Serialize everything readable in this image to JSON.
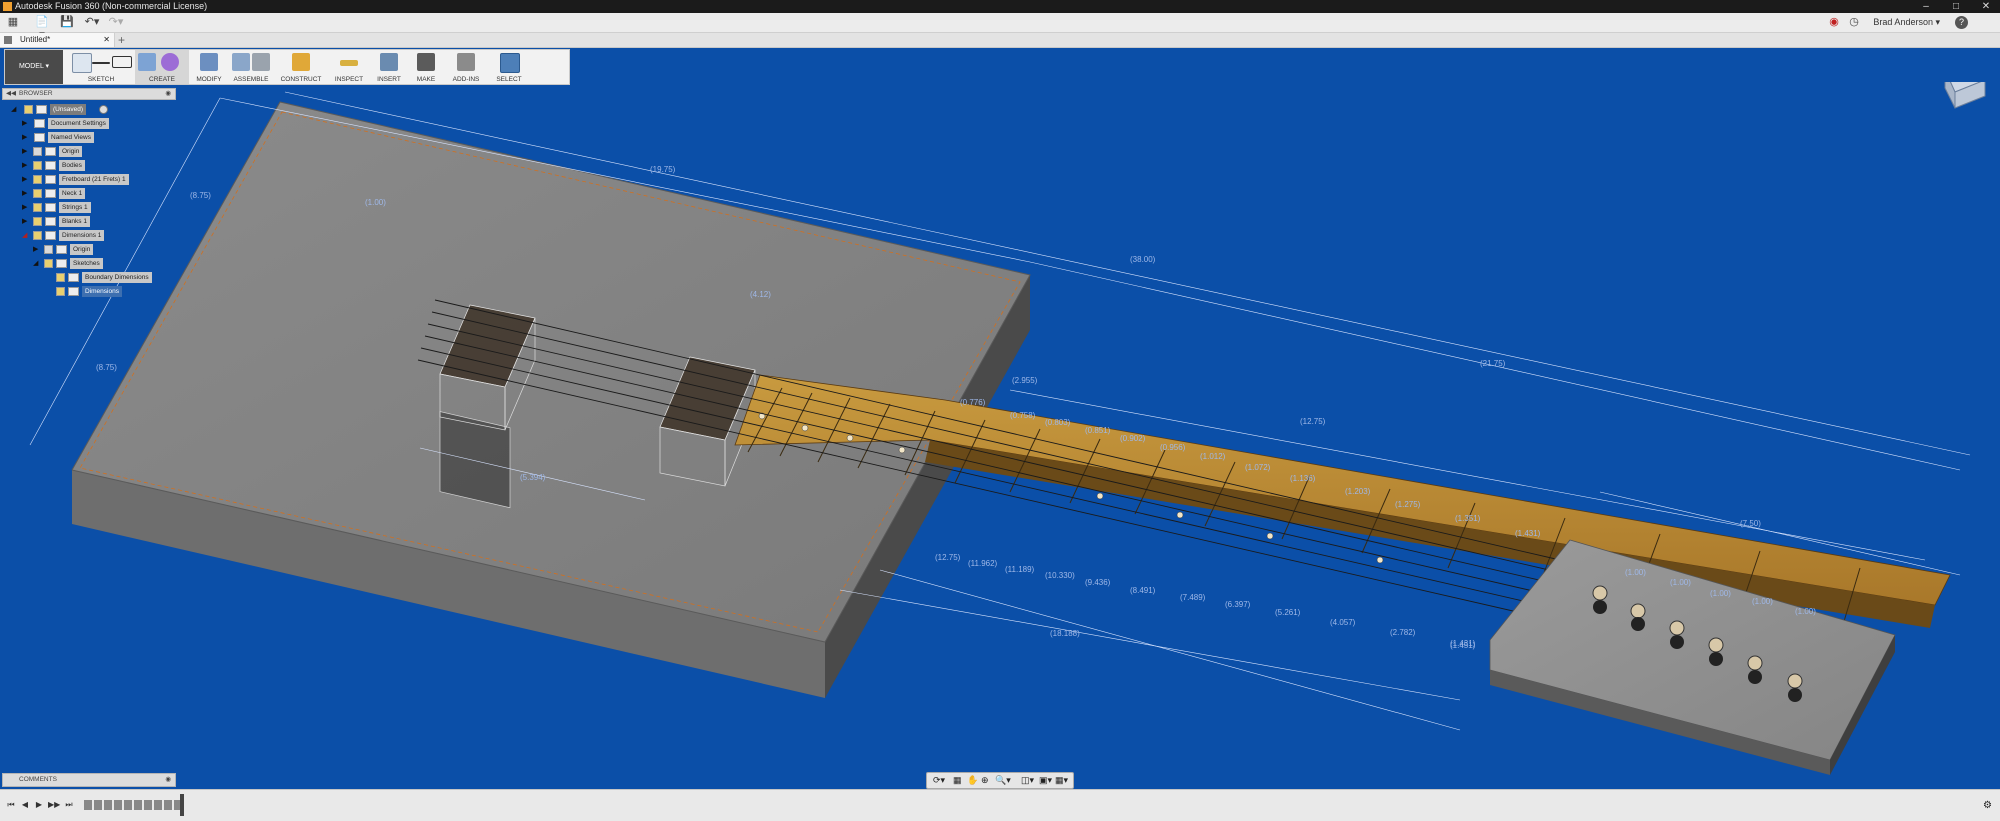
{
  "window": {
    "title": "Autodesk Fusion 360 (Non-commercial License)",
    "user": "Brad Anderson"
  },
  "tabs": [
    {
      "label": "Untitled*"
    }
  ],
  "ribbon": {
    "workspace": "MODEL",
    "groups": [
      {
        "label": "SKETCH"
      },
      {
        "label": "CREATE"
      },
      {
        "label": "MODIFY"
      },
      {
        "label": "ASSEMBLE"
      },
      {
        "label": "CONSTRUCT"
      },
      {
        "label": "INSPECT"
      },
      {
        "label": "INSERT"
      },
      {
        "label": "MAKE"
      },
      {
        "label": "ADD-INS"
      },
      {
        "label": "SELECT"
      }
    ]
  },
  "browser": {
    "title": "BROWSER",
    "items": [
      {
        "label": "(Unsaved)"
      },
      {
        "label": "Document Settings"
      },
      {
        "label": "Named Views"
      },
      {
        "label": "Origin"
      },
      {
        "label": "Bodies"
      },
      {
        "label": "Fretboard (21 Frets) 1"
      },
      {
        "label": "Neck 1"
      },
      {
        "label": "Strings 1"
      },
      {
        "label": "Blanks 1"
      },
      {
        "label": "Dimensions 1"
      },
      {
        "label": "Origin"
      },
      {
        "label": "Sketches"
      },
      {
        "label": "Boundary Dimensions"
      },
      {
        "label": "Dimensions"
      }
    ]
  },
  "comments": {
    "title": "COMMENTS"
  },
  "dimensions": {
    "body_length": "(19.75)",
    "overall": "(38.00)",
    "neck_length": "(21.75)",
    "scale_half": "(12.75)",
    "headstock": "(7.50)",
    "bottom_total": "(18.188)",
    "width_left": "(8.75)",
    "width_left2": "(8.75)",
    "pickup_span": "(5.394)",
    "offset_top": "(1.00)",
    "pickup_len": "(4.12)",
    "nut_offset": "(1.451)",
    "tuner_1": "(1.00)",
    "tuner_2": "(1.00)",
    "tuner_3": "(1.00)",
    "tuner_4": "(1.00)",
    "tuner_5": "(1.00)",
    "fret_top": [
      "(0.776)",
      "(0.758)",
      "(0.803)",
      "(0.851)",
      "(0.902)",
      "(0.956)",
      "(1.012)",
      "(1.072)",
      "(1.136)",
      "(1.203)",
      "(1.275)",
      "(1.351)",
      "(1.431)"
    ],
    "fret_bottom": [
      "(12.75)",
      "(11.962)",
      "(11.189)",
      "(10.330)",
      "(9.436)",
      "(8.491)",
      "(7.489)",
      "(6.397)",
      "(5.261)",
      "(4.057)",
      "(2.782)",
      "(1.431)"
    ],
    "fret_small": "(2.955)"
  }
}
